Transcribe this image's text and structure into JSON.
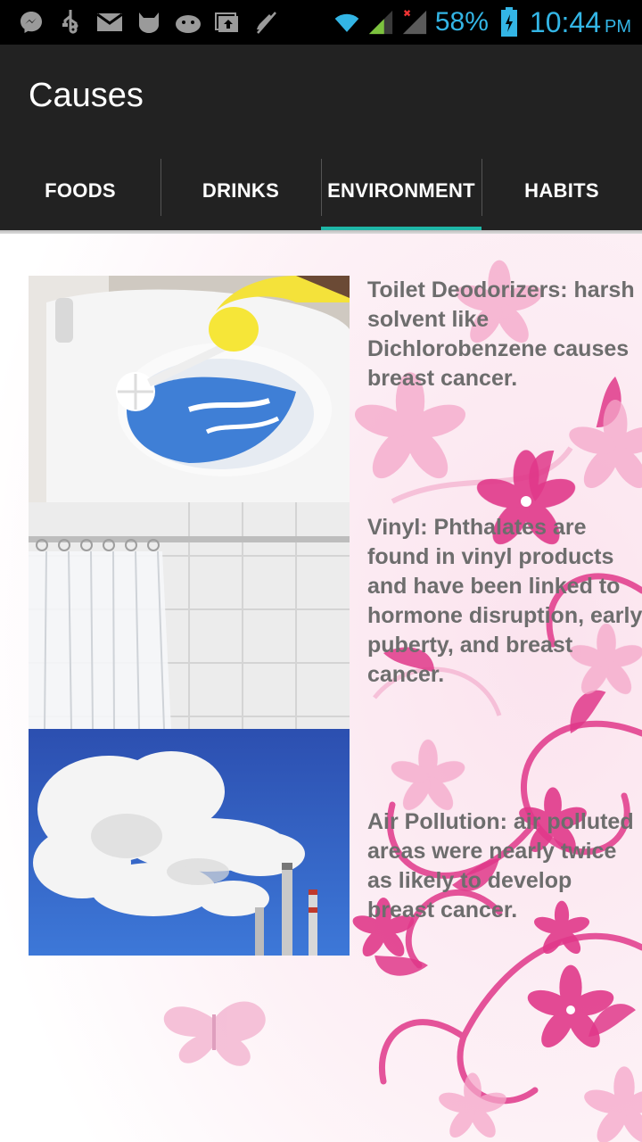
{
  "status_bar": {
    "battery_percent": "58%",
    "time": "10:44",
    "ampm": "PM",
    "icons": [
      "messenger-icon",
      "usb-icon",
      "mail-icon",
      "cat-icon",
      "android-icon",
      "upload-icon",
      "mute-icon",
      "wifi-icon",
      "signal-icon",
      "signal-off-icon",
      "battery-icon"
    ]
  },
  "app": {
    "title": "Causes"
  },
  "tabs": [
    {
      "label": "FOODS"
    },
    {
      "label": "DRINKS"
    },
    {
      "label": "ENVIRONMENT"
    },
    {
      "label": "HABITS"
    }
  ],
  "active_tab": "ENVIRONMENT",
  "items": [
    {
      "image": "toilet-cleaning-image",
      "text": "Toilet Deodorizers: harsh solvent like Dichlorobenzene causes breast cancer."
    },
    {
      "image": "vinyl-shower-curtain-image",
      "text": "Vinyl: Phthalates are found in vinyl products and have been linked to hormone disruption, early puberty, and breast cancer."
    },
    {
      "image": "factory-smoke-image",
      "text": "Air Pollution: air polluted areas were nearly twice as likely to develop breast cancer."
    }
  ],
  "colors": {
    "accent": "#1fb6a7",
    "bar": "#222222",
    "status": "#33b5e5",
    "text": "#6d6d6d",
    "floral": "#e0388a"
  }
}
